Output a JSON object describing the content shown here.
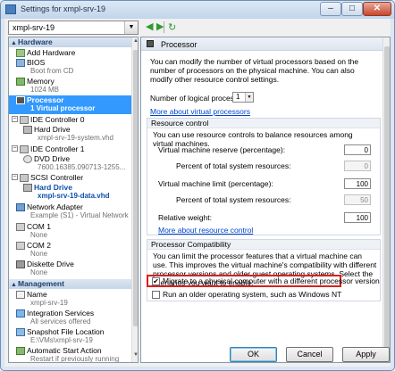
{
  "window": {
    "title": "Settings for xmpl-srv-19",
    "min": "–",
    "max": "□",
    "close": "✕"
  },
  "toolbar": {
    "vm_name": "xmpl-srv-19",
    "back": "◀",
    "forward": "▶",
    "refresh": "↻"
  },
  "sidebar": {
    "hardware_header": "Hardware",
    "management_header": "Management",
    "items": [
      {
        "name": "Add Hardware",
        "sub": ""
      },
      {
        "name": "BIOS",
        "sub": "Boot from CD"
      },
      {
        "name": "Memory",
        "sub": "1024 MB"
      },
      {
        "name": "Processor",
        "sub": "1 Virtual processor"
      },
      {
        "name": "IDE Controller 0",
        "sub": ""
      },
      {
        "name": "Hard Drive",
        "sub": "xmpl-srv-19-system.vhd"
      },
      {
        "name": "IDE Controller 1",
        "sub": ""
      },
      {
        "name": "DVD Drive",
        "sub": "7600.16385.090713-1255..."
      },
      {
        "name": "SCSI Controller",
        "sub": ""
      },
      {
        "name": "Hard Drive",
        "sub": "xmpl-srv-19-data.vhd"
      },
      {
        "name": "Network Adapter",
        "sub": "Example (S1) - Virtual Network"
      },
      {
        "name": "COM 1",
        "sub": "None"
      },
      {
        "name": "COM 2",
        "sub": "None"
      },
      {
        "name": "Diskette Drive",
        "sub": "None"
      },
      {
        "name": "Name",
        "sub": "xmpl-srv-19"
      },
      {
        "name": "Integration Services",
        "sub": "All services offered"
      },
      {
        "name": "Snapshot File Location",
        "sub": "E:\\VMs\\xmpl-srv-19"
      },
      {
        "name": "Automatic Start Action",
        "sub": "Restart if previously running"
      }
    ]
  },
  "main": {
    "header": "Processor",
    "intro": "You can modify the number of virtual processors based on the number of processors on the physical machine. You can also modify other resource control settings.",
    "num_label": "Number of logical processors:",
    "num_value": "1",
    "more_vp": "More about virtual processors",
    "rc": {
      "header": "Resource control",
      "desc": "You can use resource controls to balance resources among virtual machines.",
      "reserve_label": "Virtual machine reserve (percentage):",
      "reserve_value": "0",
      "pct1_label": "Percent of total system resources:",
      "pct1_value": "0",
      "limit_label": "Virtual machine limit (percentage):",
      "limit_value": "100",
      "pct2_label": "Percent of total system resources:",
      "pct2_value": "50",
      "weight_label": "Relative weight:",
      "weight_value": "100",
      "more_rc": "More about resource control"
    },
    "compat": {
      "header": "Processor Compatibility",
      "desc": "You can limit the processor features that a virtual machine can use. This improves the virtual machine's compatibility with different processor versions and older guest operating systems. Select the scenarios you want to enable:",
      "migrate_label": "Migrate to a physical computer with a different processor version",
      "migrate_checked": true,
      "older_label": "Run an older operating system, such as Windows NT",
      "older_checked": false,
      "check_mark": "✔"
    }
  },
  "buttons": {
    "ok": "OK",
    "cancel": "Cancel",
    "apply": "Apply"
  }
}
